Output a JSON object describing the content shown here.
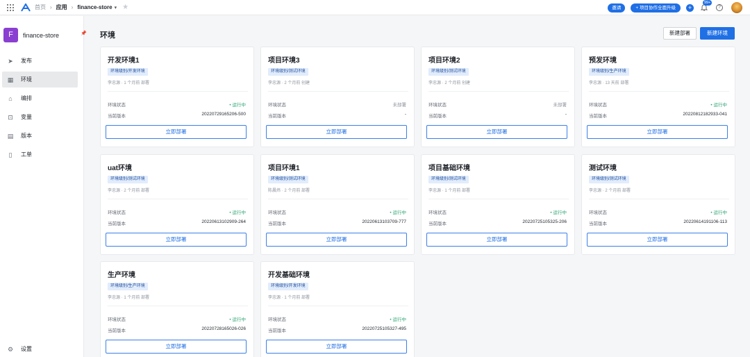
{
  "topbar": {
    "breadcrumb": [
      "首页",
      "应用",
      "finance-store"
    ],
    "pill_primary": "邀请",
    "pill_secondary": "+ 项目协作全面升级",
    "notification_count": "99+",
    "help": "?"
  },
  "sidebar": {
    "project_logo": "F",
    "project_name": "finance-store",
    "items": [
      {
        "label": "发布",
        "icon": "send-icon"
      },
      {
        "label": "环境",
        "icon": "environment-icon",
        "active": true
      },
      {
        "label": "编排",
        "icon": "orchestrate-icon"
      },
      {
        "label": "变量",
        "icon": "variable-icon"
      },
      {
        "label": "版本",
        "icon": "version-icon"
      },
      {
        "label": "工单",
        "icon": "ticket-icon"
      }
    ],
    "settings_label": "设置"
  },
  "main": {
    "title": "环境",
    "new_deploy_label": "新建部署",
    "new_env_label": "新建环境",
    "status_label": "环境状态",
    "version_label": "当前版本",
    "deploy_label": "立即部署",
    "envs": [
      {
        "name": "开发环境1",
        "tag": "环境级别/开发环境",
        "meta": "李忠源 · 1 个月前 部署",
        "status": "• 运行中",
        "running": true,
        "version": "20220729165206-500"
      },
      {
        "name": "项目环境3",
        "tag": "环境级别/测试环境",
        "meta": "李忠源 · 2 个月前 创建",
        "status": "未部署",
        "running": false,
        "version": "-"
      },
      {
        "name": "项目环境2",
        "tag": "环境级别/测试环境",
        "meta": "李忠源 · 2 个月前 创建",
        "status": "未部署",
        "running": false,
        "version": "-"
      },
      {
        "name": "预发环境",
        "tag": "环境级别/生产环境",
        "meta": "李忠源 · 13 天前 部署",
        "status": "• 运行中",
        "running": true,
        "version": "20220812182933-041"
      },
      {
        "name": "uat环境",
        "tag": "环境级别/测试环境",
        "meta": "李忠源 · 2 个月前 部署",
        "status": "• 运行中",
        "running": true,
        "version": "20220613102909-264"
      },
      {
        "name": "项目环境1",
        "tag": "环境级别/测试环境",
        "meta": "陈晨炜 · 2 个月前 部署",
        "status": "• 运行中",
        "running": true,
        "version": "20220613103709-777"
      },
      {
        "name": "项目基础环境",
        "tag": "环境级别/测试环境",
        "meta": "李忠源 · 1 个月前 部署",
        "status": "• 运行中",
        "running": true,
        "version": "20220725105325-206"
      },
      {
        "name": "测试环境",
        "tag": "环境级别/测试环境",
        "meta": "李忠源 · 2 个月前 部署",
        "status": "• 运行中",
        "running": true,
        "version": "20220614191106-113"
      },
      {
        "name": "生产环境",
        "tag": "环境级别/生产环境",
        "meta": "李忠源 · 1 个月前 部署",
        "status": "• 运行中",
        "running": true,
        "version": "20220728165026-026"
      },
      {
        "name": "开发基础环境",
        "tag": "环境级别/开发环境",
        "meta": "李忠源 · 1 个月前 部署",
        "status": "• 运行中",
        "running": true,
        "version": "20220725105327-495"
      }
    ]
  },
  "colors": {
    "accent": "#1f6fe5",
    "running": "#2ba471",
    "project_logo": "#8a3fd1"
  }
}
